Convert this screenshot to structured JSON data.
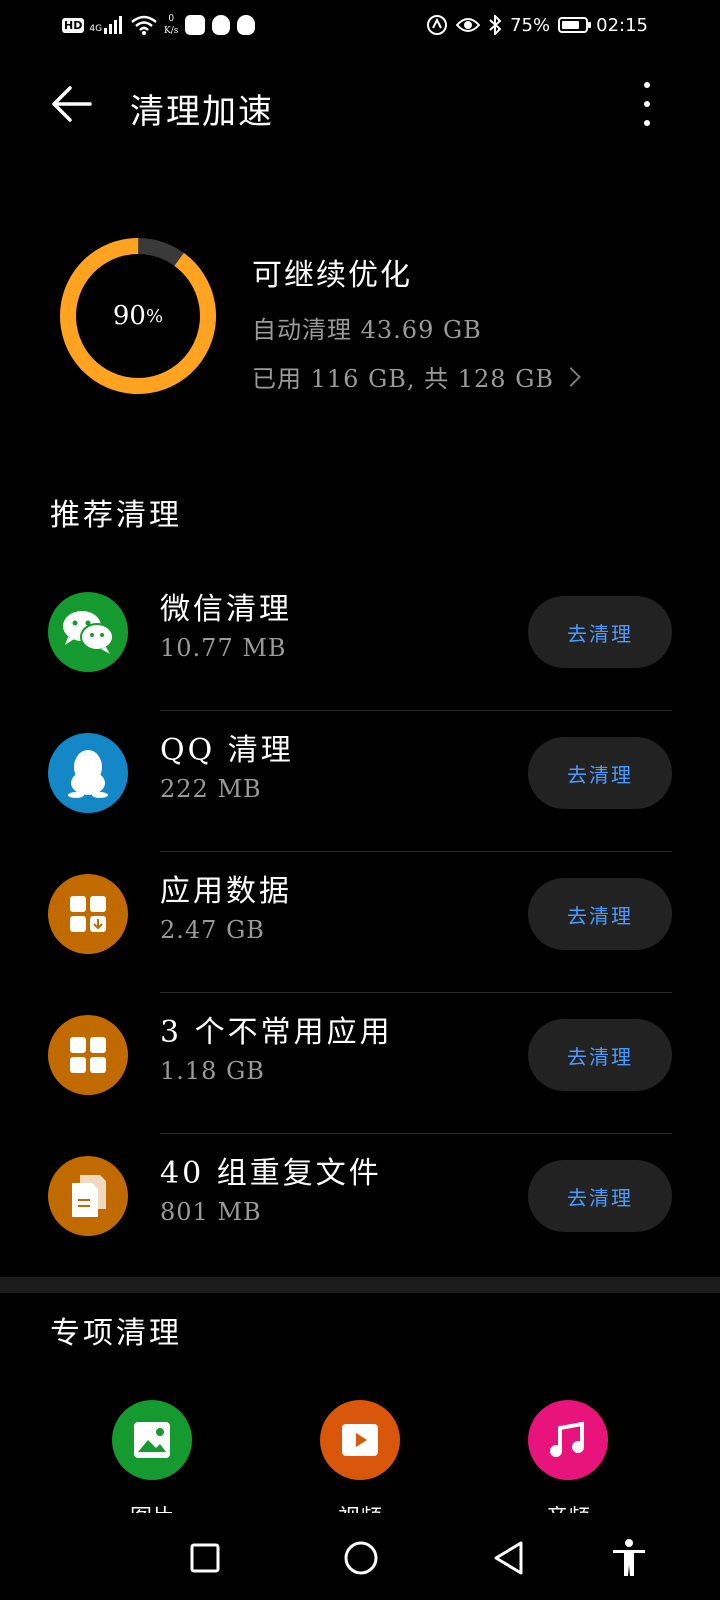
{
  "status_bar": {
    "hd": "HD",
    "network": "4G",
    "speed_value": "0",
    "speed_unit": "K/s",
    "battery_percent": "75%",
    "battery_level": 0.75,
    "time": "02:15"
  },
  "header": {
    "title": "清理加速"
  },
  "summary": {
    "ring_value": 90,
    "ring_percent": "90",
    "ring_unit": "%",
    "ring_color": "#FFA321",
    "ring_track_color": "#3a3a3a",
    "title": "可继续优化",
    "auto_clean": "自动清理 43.69 GB",
    "usage": "已用 116 GB, 共 128 GB"
  },
  "recommended": {
    "title": "推荐清理",
    "button_label": "去清理",
    "items": [
      {
        "name": "微信清理",
        "size": "10.77 MB",
        "color": "#149A2E",
        "icon": "wechat-icon"
      },
      {
        "name": "QQ 清理",
        "size": "222 MB",
        "color": "#1487C6",
        "icon": "qq-penguin-icon"
      },
      {
        "name": "应用数据",
        "size": "2.47 GB",
        "color": "#C16A00",
        "icon": "app-data-icon"
      },
      {
        "name": "3 个不常用应用",
        "size": "1.18 GB",
        "color": "#C16A00",
        "icon": "apps-grid-icon"
      },
      {
        "name": "40 组重复文件",
        "size": "801 MB",
        "color": "#C16A00",
        "icon": "duplicate-file-icon"
      }
    ]
  },
  "special": {
    "title": "专项清理",
    "items": [
      {
        "label": "图片",
        "color": "#149A2E",
        "icon": "image-icon"
      },
      {
        "label": "视频",
        "color": "#D9570A",
        "icon": "video-icon"
      },
      {
        "label": "音频",
        "color": "#E8147C",
        "icon": "music-icon"
      }
    ]
  }
}
